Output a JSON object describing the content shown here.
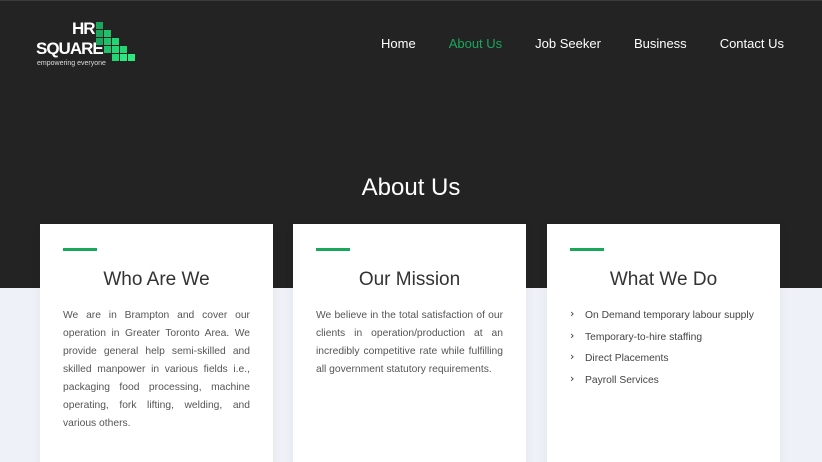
{
  "brand": {
    "line1": "HR",
    "line2": "SQUARE",
    "tagline": "empowering everyone",
    "accent_color": "#19a75b"
  },
  "nav": {
    "items": [
      {
        "label": "Home",
        "active": false
      },
      {
        "label": "About Us",
        "active": true
      },
      {
        "label": "Job Seeker",
        "active": false
      },
      {
        "label": "Business",
        "active": false
      },
      {
        "label": "Contact Us",
        "active": false
      }
    ]
  },
  "hero": {
    "title": "About Us",
    "background": "#232323"
  },
  "cards": [
    {
      "title": "Who Are We",
      "body": "We are in Brampton and cover our operation in Greater Toronto Area. We provide general help semi-skilled and skilled manpower in various fields i.e., packaging food processing, machine operating, fork lifting, welding, and various others."
    },
    {
      "title": "Our Mission",
      "body": "We believe in the total satisfaction of our clients in operation/production at an incredibly competitive rate while fulfilling all government statutory requirements."
    },
    {
      "title": "What We Do",
      "items": [
        "On Demand temporary labour supply",
        "Temporary-to-hire staffing",
        "Direct Placements",
        "Payroll Services"
      ],
      "bullet_icon": "chevron-right-icon"
    }
  ]
}
